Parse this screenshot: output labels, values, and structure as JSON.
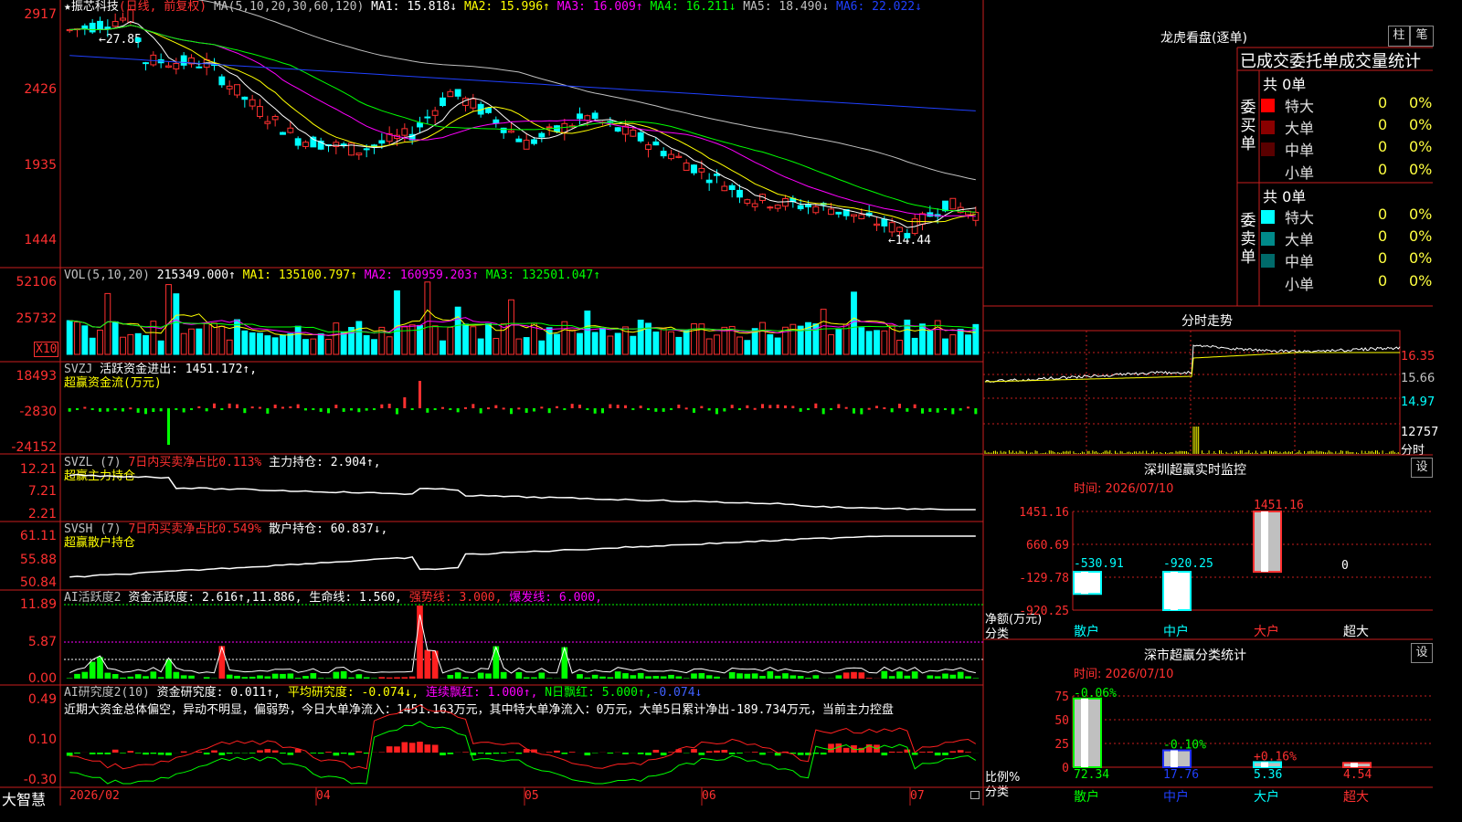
{
  "main_chart": {
    "title": "★振芯科技",
    "mode": "(日线, 前复权)",
    "ma_params": "MA(5,10,20,30,60,120)",
    "ma_values": [
      {
        "name": "MA1",
        "value": "15.818↓",
        "color": "#ffffff"
      },
      {
        "name": "MA2",
        "value": "15.996↑",
        "color": "#ffff00"
      },
      {
        "name": "MA3",
        "value": "16.009↑",
        "color": "#ff00ff"
      },
      {
        "name": "MA4",
        "value": "16.211↓",
        "color": "#00ff00"
      },
      {
        "name": "MA5",
        "value": "18.490↓",
        "color": "#c0c0c0"
      },
      {
        "name": "MA6",
        "value": "22.022↓",
        "color": "#2040ff"
      }
    ],
    "y_ticks": [
      "2917",
      "2426",
      "1935",
      "1444"
    ],
    "high_label": "27.85",
    "low_label": "14.44"
  },
  "vol_panel": {
    "label": "VOL(5,10,20)",
    "value": "215349.000↑",
    "ma": [
      {
        "name": "MA1",
        "value": "135100.797↑",
        "color": "#ffff00"
      },
      {
        "name": "MA2",
        "value": "160959.203↑",
        "color": "#ff00ff"
      },
      {
        "name": "MA3",
        "value": "132501.047↑",
        "color": "#00ff00"
      }
    ],
    "y_ticks": [
      "52106",
      "25732"
    ],
    "unit": "X10"
  },
  "svzj_panel": {
    "label": "SVZJ",
    "name": "活跃资金进出:",
    "value": "1451.172↑,",
    "subtitle": "超赢资金流(万元)",
    "y_ticks": [
      "18493",
      "-2830",
      "-24152"
    ]
  },
  "svzl_panel": {
    "label": "SVZL (7)",
    "ratio_text": "7日内买卖净占比0.113%",
    "holding": "主力持仓: 2.904↑,",
    "subtitle": "超赢主力持仓",
    "y_ticks": [
      "12.21",
      "7.21",
      "2.21"
    ]
  },
  "svsh_panel": {
    "label": "SVSH (7)",
    "ratio_text": "7日内买卖净占比0.549%",
    "holding": "散户持仓: 60.837↓,",
    "subtitle": "超赢散户持仓",
    "y_ticks": [
      "61.11",
      "55.88",
      "50.84"
    ]
  },
  "ai_active_panel": {
    "label": "AI活跃度2",
    "text1": "资金活跃度: 2.616↑,11.886,",
    "text2": "生命线: 1.560,",
    "strong": "强势线: 3.000,",
    "burst": "爆发线: 6.000,",
    "y_ticks": [
      "11.89",
      "5.87",
      "0.00"
    ]
  },
  "ai_research_panel": {
    "label": "AI研究度2(10)",
    "text1": "资金研究度: 0.011↑,",
    "text2": "平均研究度: -0.074↓,",
    "text3": "连续飘红: 1.000↑,",
    "text4": "N日飘红: 5.000↑,",
    "text5": "-0.074↓",
    "commentary": "近期大资金总体偏空，异动不明显，偏弱势，今日大单净流入：1451.163万元，其中特大单净流入：0万元，大单5日累计净出-189.734万元，当前主力控盘",
    "y_ticks": [
      "0.49",
      "0.10",
      "-0.30"
    ]
  },
  "x_axis": {
    "app_name": "大智慧",
    "labels": [
      "2026/02",
      "04",
      "05",
      "06",
      "07"
    ]
  },
  "dragon_tiger": {
    "title": "龙虎看盘(逐单)",
    "btn_a": "柱",
    "btn_b": "笔",
    "subtitle": "已成交委托单成交量统计",
    "buy": {
      "side": "委买单",
      "total": "共 0单",
      "rows": [
        {
          "label": "特大",
          "count": "0",
          "pct": "0%",
          "color": "#ff0000"
        },
        {
          "label": "大单",
          "count": "0",
          "pct": "0%",
          "color": "#8a0000"
        },
        {
          "label": "中单",
          "count": "0",
          "pct": "0%",
          "color": "#5a0000"
        },
        {
          "label": "小单",
          "count": "0",
          "pct": "0%",
          "color": "#000000"
        }
      ]
    },
    "sell": {
      "side": "委卖单",
      "total": "共 0单",
      "rows": [
        {
          "label": "特大",
          "count": "0",
          "pct": "0%",
          "color": "#00ffff"
        },
        {
          "label": "大单",
          "count": "0",
          "pct": "0%",
          "color": "#008a8a"
        },
        {
          "label": "中单",
          "count": "0",
          "pct": "0%",
          "color": "#006a6a"
        },
        {
          "label": "小单",
          "count": "0",
          "pct": "0%",
          "color": "#000000"
        }
      ]
    }
  },
  "intraday": {
    "title": "分时走势",
    "price_ticks": [
      "16.35",
      "15.66",
      "14.97"
    ],
    "vol_tick": "12757",
    "vol_label": "分时"
  },
  "sz_monitor": {
    "title": "深圳超赢实时监控",
    "set_btn": "设",
    "time": "时间: 2026/07/10",
    "y_ticks": [
      "1451.16",
      "660.69",
      "-129.78",
      "-920.25"
    ],
    "ylabel": "净额(万元)",
    "xlabel": "分类",
    "chart_data": {
      "type": "bar",
      "categories": [
        "散户",
        "中户",
        "大户",
        "超大"
      ],
      "values": [
        -530.91,
        -920.25,
        1451.16,
        0
      ],
      "value_labels": [
        "-530.91",
        "-920.25",
        "1451.16",
        "0"
      ],
      "ylim": [
        -920.25,
        1451.16
      ]
    }
  },
  "sz_category": {
    "title": "深市超赢分类统计",
    "set_btn": "设",
    "time": "时间: 2026/07/10",
    "y_ticks": [
      "75",
      "50",
      "25",
      "0"
    ],
    "ylabel": "比例%",
    "xlabel": "分类",
    "chart_data": {
      "type": "bar",
      "categories": [
        "散户",
        "中户",
        "大户",
        "超大"
      ],
      "values": [
        72.34,
        17.76,
        5.36,
        4.54
      ],
      "value_labels": [
        "72.34",
        "17.76",
        "5.36",
        "4.54"
      ],
      "change_labels": [
        "-0.06%",
        "-0.10%",
        "+0.16%",
        ""
      ],
      "ylim": [
        0,
        75
      ]
    }
  }
}
